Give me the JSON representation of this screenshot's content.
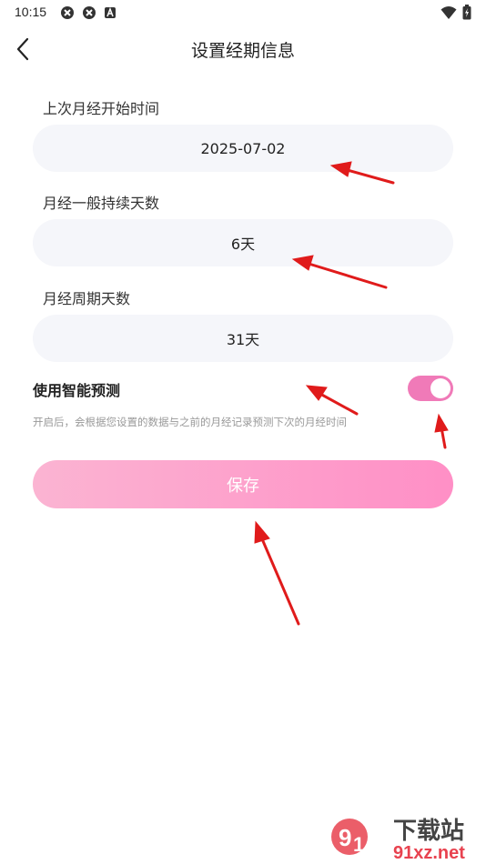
{
  "status_bar": {
    "time": "10:15",
    "left_icons": [
      "sync-icon",
      "sync-icon",
      "a-badge-icon"
    ],
    "right_icons": [
      "wifi-icon",
      "battery-icon"
    ]
  },
  "header": {
    "title": "设置经期信息",
    "back_icon": "chevron-left-icon"
  },
  "form": {
    "last_period": {
      "label": "上次月经开始时间",
      "value": "2025-07-02"
    },
    "duration": {
      "label": "月经一般持续天数",
      "value": "6天"
    },
    "cycle": {
      "label": "月经周期天数",
      "value": "31天"
    }
  },
  "smart_predict": {
    "label": "使用智能预测",
    "enabled": true,
    "description": "开启后，会根据您设置的数据与之前的月经记录预测下次的月经时间"
  },
  "save_label": "保存",
  "colors": {
    "accent": "#f07ab8",
    "pill_bg": "#f5f6fa",
    "save_gradient_start": "#fbb4d2",
    "save_gradient_end": "#ff8fc6",
    "annotation": "#e01b1b"
  },
  "watermark": {
    "text_main": "下载站",
    "text_site": "91xz.net"
  }
}
